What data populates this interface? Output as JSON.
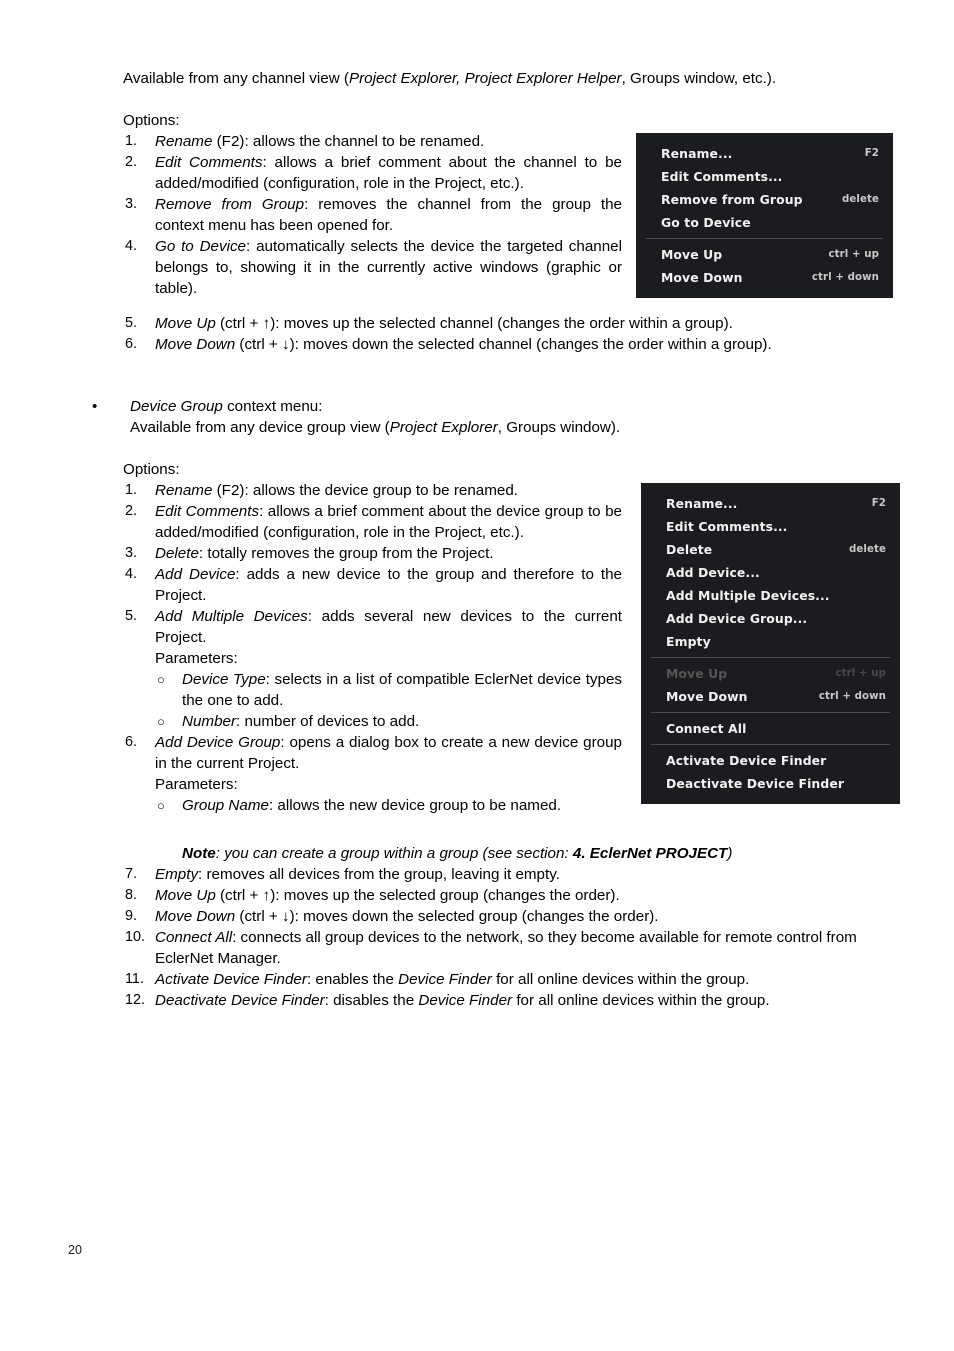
{
  "page": {
    "number": "20"
  },
  "intro": {
    "line_prefix": "Available from any channel view (",
    "italic_1": "Project Explorer, Project Explorer Helper",
    "line_suffix": ", Groups window, etc.)."
  },
  "channel_section": {
    "options_label": "Options:",
    "items": [
      {
        "num": "1.",
        "term": "Rename",
        "rest": " (F2): allows the channel to be renamed."
      },
      {
        "num": "2.",
        "term": "Edit Comments",
        "rest": ": allows a brief comment about the channel to be added/modified (configuration, role in the Project, etc.)."
      },
      {
        "num": "3.",
        "term": "Remove from Group",
        "rest": ": removes the channel from the group the context menu has been opened for."
      },
      {
        "num": "4.",
        "term": "Go to Device",
        "rest": ": automatically selects the device the targeted channel belongs to, showing it in the currently active windows (graphic or table)."
      },
      {
        "num": "5.",
        "term": "Move Up",
        "rest": " (ctrl + ↑): moves up the selected channel (changes the order within a group)."
      },
      {
        "num": "6.",
        "term": "Move Down",
        "rest": " (ctrl + ↓): moves down the selected channel (changes the order within a group)."
      }
    ]
  },
  "device_group_heading": {
    "bullet": "•",
    "term": "Device Group",
    "rest": " context menu:",
    "available_prefix": "Available from any device group view (",
    "available_italic": "Project Explorer",
    "available_suffix": ", Groups window)."
  },
  "device_group_section": {
    "options_label": "Options:",
    "items": [
      {
        "num": "1.",
        "term": "Rename",
        "rest": " (F2): allows the device group to be renamed."
      },
      {
        "num": "2.",
        "term": "Edit Comments",
        "rest": ": allows a brief comment about the device group to be added/modified (configuration, role in the Project, etc.)."
      },
      {
        "num": "3.",
        "term": "Delete",
        "rest": ": totally removes the group from the Project."
      },
      {
        "num": "4.",
        "term": "Add Device",
        "rest": ": adds a new device to the group and therefore to the Project."
      },
      {
        "num": "5.",
        "term": "Add Multiple Devices",
        "rest": ": adds several new devices to the current Project."
      }
    ],
    "params_label_1": "Parameters:",
    "subitems_1": [
      {
        "bullet": "○",
        "term": "Device Type",
        "rest": ": selects in a list of compatible EclerNet device types the one to add."
      },
      {
        "bullet": "○",
        "term": "Number",
        "rest": ": number of devices to add."
      }
    ],
    "item_6": {
      "num": "6.",
      "term": "Add Device Group",
      "rest": ": opens a dialog box to create a new device group in the current Project."
    },
    "params_label_2": "Parameters:",
    "subitems_2": [
      {
        "bullet": "○",
        "term": "Group Name",
        "rest": ": allows the new device group to be named."
      }
    ],
    "note": {
      "label": "Note",
      "text": ": you can create a group within a group (see section: ",
      "ref": "4. EclerNet PROJECT",
      "tail": ")"
    },
    "items_tail": [
      {
        "num": "7.",
        "term": "Empty",
        "rest": ": removes all devices from the group, leaving it empty."
      },
      {
        "num": "8.",
        "term": "Move Up",
        "rest": " (ctrl + ↑): moves up the selected group (changes the order)."
      },
      {
        "num": "9.",
        "term": "Move Down",
        "rest": " (ctrl + ↓): moves down the selected group (changes the order)."
      },
      {
        "num": "10.",
        "term": "Connect All",
        "rest": ": connects all group devices to the network, so they become available for remote control from EclerNet Manager."
      },
      {
        "num": "11.",
        "term": "Activate Device Finder",
        "rest_a": ": enables the ",
        "term_b": "Device Finder",
        "rest_b": " for all online devices within the group."
      },
      {
        "num": "12.",
        "term": "Deactivate Device Finder",
        "rest_a": ": disables the ",
        "term_b": "Device Finder",
        "rest_b": " for all online devices within the group."
      }
    ]
  },
  "channel_context_menu": {
    "background_color": "#1b1c20",
    "text_color": "#f2f2f2",
    "rows": [
      {
        "label": "Rename...",
        "accel": "F2"
      },
      {
        "label": "Edit Comments...",
        "accel": ""
      },
      {
        "label": "Remove from Group",
        "accel": "delete"
      },
      {
        "label": "Go to Device",
        "accel": ""
      },
      {
        "separator": true
      },
      {
        "label": "Move Up",
        "accel": "ctrl + up"
      },
      {
        "label": "Move Down",
        "accel": "ctrl + down"
      }
    ]
  },
  "device_group_context_menu": {
    "background_color": "#1b1c20",
    "text_color": "#f2f2f2",
    "disabled_color": "#565656",
    "rows": [
      {
        "label": "Rename...",
        "accel": "F2"
      },
      {
        "label": "Edit Comments...",
        "accel": ""
      },
      {
        "label": "Delete",
        "accel": "delete"
      },
      {
        "label": "Add Device...",
        "accel": ""
      },
      {
        "label": "Add Multiple Devices...",
        "accel": ""
      },
      {
        "label": "Add Device Group...",
        "accel": ""
      },
      {
        "label": "Empty",
        "accel": ""
      },
      {
        "separator": true
      },
      {
        "label": "Move Up",
        "accel": "ctrl + up",
        "disabled": true
      },
      {
        "label": "Move Down",
        "accel": "ctrl + down"
      },
      {
        "separator": true
      },
      {
        "label": "Connect All",
        "accel": ""
      },
      {
        "separator": true
      },
      {
        "label": "Activate Device Finder",
        "accel": ""
      },
      {
        "label": "Deactivate Device Finder",
        "accel": ""
      }
    ]
  }
}
